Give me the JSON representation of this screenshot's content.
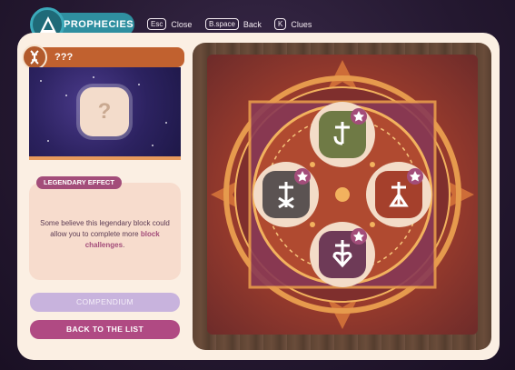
{
  "header": {
    "title": "PROPHECIES",
    "hints": [
      {
        "key": "Esc",
        "label": "Close"
      },
      {
        "key": "B.space",
        "label": "Back"
      },
      {
        "key": "K",
        "label": "Clues"
      }
    ]
  },
  "block": {
    "name": "???",
    "preview_glyph": "?"
  },
  "effect": {
    "tag": "LEGENDARY EFFECT",
    "text_before": "Some believe this legendary block could allow you to complete more",
    "highlight": "block challenges",
    "text_after": "."
  },
  "buttons": {
    "compendium": "COMPENDIUM",
    "back_to_list": "BACK TO THE LIST"
  },
  "board": {
    "runes": [
      {
        "position": "top",
        "color": "#6f7a45",
        "symbol": "rune-hook"
      },
      {
        "position": "left",
        "color": "#5b5352",
        "symbol": "rune-cross"
      },
      {
        "position": "right",
        "color": "#a5402c",
        "symbol": "rune-tower"
      },
      {
        "position": "bottom",
        "color": "#6e3a57",
        "symbol": "rune-heart"
      }
    ]
  },
  "colors": {
    "accent": "#a34d7a",
    "header": "#2f8fa0",
    "name_bar": "#c1612f"
  }
}
